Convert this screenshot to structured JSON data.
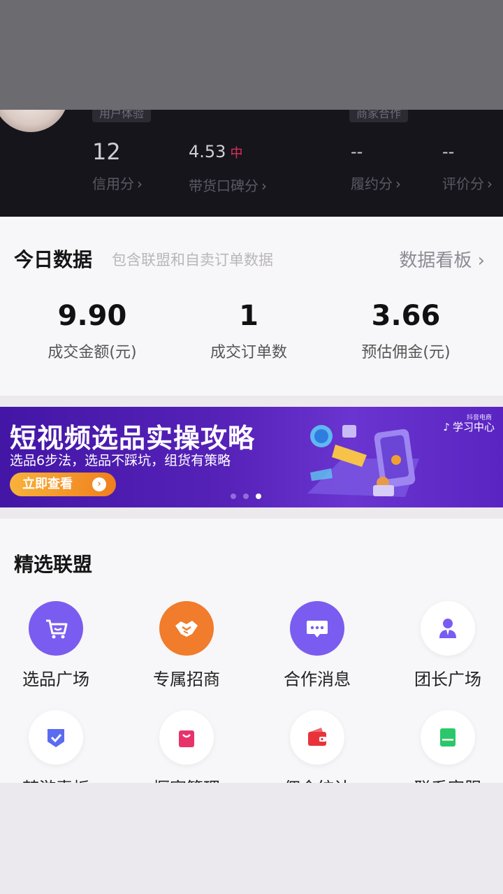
{
  "profile": {
    "tag_left": "用户体验",
    "tag_right": "商家合作",
    "stats": [
      {
        "value": "12",
        "label": "信用分"
      },
      {
        "value": "4.53",
        "suffix": "中",
        "label": "带货口碑分"
      },
      {
        "value": "--",
        "label": "履约分"
      },
      {
        "value": "--",
        "label": "评价分"
      }
    ],
    "arrow": "›"
  },
  "today": {
    "title": "今日数据",
    "subtitle": "包含联盟和自卖订单数据",
    "dashboard_link": "数据看板 ›",
    "metrics": [
      {
        "value": "9.90",
        "label": "成交金额(元)"
      },
      {
        "value": "1",
        "label": "成交订单数"
      },
      {
        "value": "3.66",
        "label": "预估佣金(元)"
      }
    ]
  },
  "banner": {
    "title": "短视频选品实操攻略",
    "subtitle": "选品6步法，选品不踩坑，组货有策略",
    "button": "立即查看",
    "button_icon": "›",
    "brand": "学习中心",
    "brand_small": "抖音电商",
    "active_dot": 2,
    "dot_count": 3
  },
  "alliance": {
    "title": "精选联盟",
    "items": [
      {
        "label": "选品广场",
        "icon": "cart-icon",
        "color": "#7a5cf0"
      },
      {
        "label": "专属招商",
        "icon": "handshake-icon",
        "color": "#f07c2c"
      },
      {
        "label": "合作消息",
        "icon": "message-icon",
        "color": "#7a5cf0"
      },
      {
        "label": "团长广场",
        "icon": "person-icon",
        "color": "#7a5cf0"
      },
      {
        "label": "梦游素板",
        "icon": "shield-check-icon",
        "color": "#5b6cf0"
      },
      {
        "label": "橱窗管理",
        "icon": "bag-icon",
        "color": "#e8336a"
      },
      {
        "label": "佣金统计",
        "icon": "wallet-icon",
        "color": "#e8333a"
      },
      {
        "label": "联系客服",
        "icon": "store-icon",
        "color": "#2cc76a"
      }
    ]
  }
}
